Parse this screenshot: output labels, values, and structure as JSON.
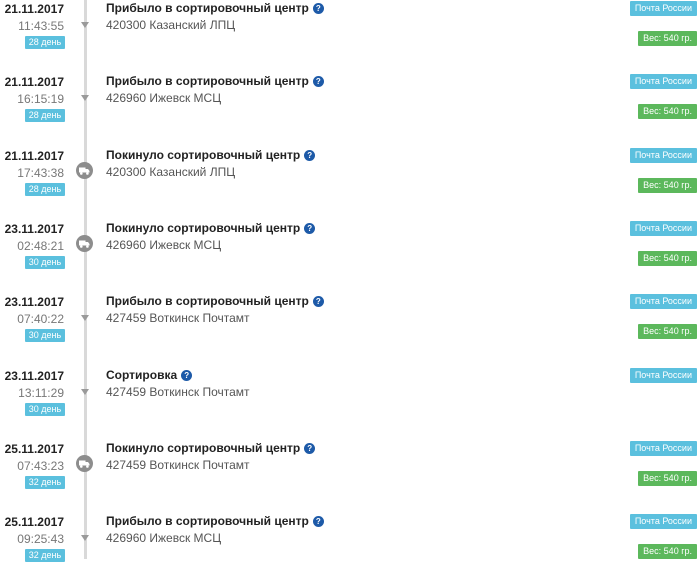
{
  "events": [
    {
      "date": "21.11.2017",
      "time": "11:43:55",
      "days": "28 день",
      "title": "Прибыло в сортировочный центр",
      "location": "420300 Казанский ЛПЦ",
      "carrier": "Почта России",
      "weight": "Вес: 540 гр.",
      "marker": "dot"
    },
    {
      "date": "21.11.2017",
      "time": "16:15:19",
      "days": "28 день",
      "title": "Прибыло в сортировочный центр",
      "location": "426960 Ижевск МСЦ",
      "carrier": "Почта России",
      "weight": "Вес: 540 гр.",
      "marker": "dot"
    },
    {
      "date": "21.11.2017",
      "time": "17:43:38",
      "days": "28 день",
      "title": "Покинуло сортировочный центр",
      "location": "420300 Казанский ЛПЦ",
      "carrier": "Почта России",
      "weight": "Вес: 540 гр.",
      "marker": "truck"
    },
    {
      "date": "23.11.2017",
      "time": "02:48:21",
      "days": "30 день",
      "title": "Покинуло сортировочный центр",
      "location": "426960 Ижевск МСЦ",
      "carrier": "Почта России",
      "weight": "Вес: 540 гр.",
      "marker": "truck"
    },
    {
      "date": "23.11.2017",
      "time": "07:40:22",
      "days": "30 день",
      "title": "Прибыло в сортировочный центр",
      "location": "427459 Воткинск Почтамт",
      "carrier": "Почта России",
      "weight": "Вес: 540 гр.",
      "marker": "dot"
    },
    {
      "date": "23.11.2017",
      "time": "13:11:29",
      "days": "30 день",
      "title": "Сортировка",
      "location": "427459 Воткинск Почтамт",
      "carrier": "Почта России",
      "weight": "",
      "marker": "dot"
    },
    {
      "date": "25.11.2017",
      "time": "07:43:23",
      "days": "32 день",
      "title": "Покинуло сортировочный центр",
      "location": "427459 Воткинск Почтамт",
      "carrier": "Почта России",
      "weight": "Вес: 540 гр.",
      "marker": "truck"
    },
    {
      "date": "25.11.2017",
      "time": "09:25:43",
      "days": "32 день",
      "title": "Прибыло в сортировочный центр",
      "location": "426960 Ижевск МСЦ",
      "carrier": "Почта России",
      "weight": "Вес: 540 гр.",
      "marker": "dot"
    }
  ],
  "icons": {
    "help": "question-circle-icon",
    "dot": "chevron-down-icon",
    "truck": "truck-icon"
  },
  "colors": {
    "carrier_badge": "#5bc0de",
    "weight_badge": "#5cb85c",
    "help_icon": "#1d5aa8",
    "timeline": "#d9d9d9"
  }
}
